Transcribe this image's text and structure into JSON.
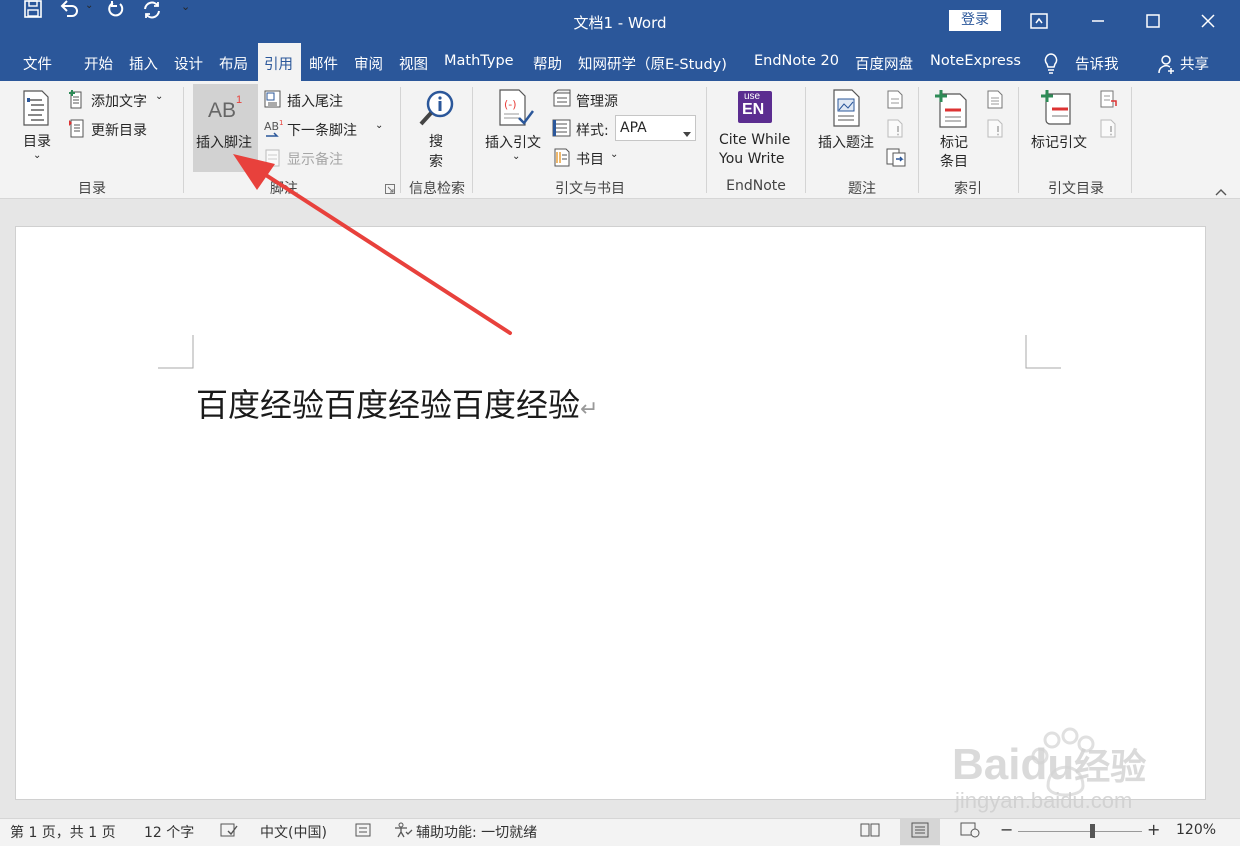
{
  "title_bar": {
    "doc_title": "文档1  -  Word",
    "login": "登录"
  },
  "tabs": [
    "文件",
    "开始",
    "插入",
    "设计",
    "布局",
    "引用",
    "邮件",
    "审阅",
    "视图",
    "MathType",
    "帮助",
    "知网研学（原E-Study)",
    "EndNote 20",
    "百度网盘",
    "NoteExpress",
    "告诉我",
    "共享"
  ],
  "active_tab": "引用",
  "ribbon": {
    "toc": {
      "toc_label": "目录",
      "add_text": "添加文字",
      "update_toc": "更新目录",
      "group": "目录"
    },
    "footnotes": {
      "insert_footnote": "插入脚注",
      "insert_endnote": "插入尾注",
      "next_footnote": "下一条脚注",
      "show_notes": "显示备注",
      "group": "脚注",
      "icon_text": "AB",
      "icon_sup": "1"
    },
    "research": {
      "search_1": "搜",
      "search_2": "索",
      "group": "信息检索"
    },
    "citations": {
      "insert_citation": "插入引文",
      "manage_sources": "管理源",
      "style_label": "样式:",
      "style_value": "APA",
      "bibliography": "书目",
      "group": "引文与书目"
    },
    "endnote": {
      "cite_1": "Cite While",
      "cite_2": "You Write",
      "group": "EndNote",
      "logo_top": "use",
      "logo_bottom": "EN"
    },
    "captions": {
      "insert_caption": "插入题注",
      "group": "题注"
    },
    "index": {
      "mark_entry_1": "标记",
      "mark_entry_2": "条目",
      "group": "索引"
    },
    "toa": {
      "mark_citation": "标记引文",
      "group": "引文目录"
    }
  },
  "document": {
    "text": "百度经验百度经验百度经验",
    "paragraph_mark": "↵"
  },
  "status_bar": {
    "page": "第 1 页，共 1 页",
    "words": "12 个字",
    "language": "中文(中国)",
    "accessibility": "辅助功能: 一切就绪",
    "zoom": "120%",
    "zoom_level": 0.6
  },
  "watermark": {
    "brand": "Baidu",
    "suffix": "经验",
    "url": "jingyan.baidu.com"
  },
  "colors": {
    "word_blue": "#2b579a",
    "annotation_red": "#e8413c",
    "endnote_purple": "#5b2d90",
    "footnote_sup": "#e8413c"
  }
}
